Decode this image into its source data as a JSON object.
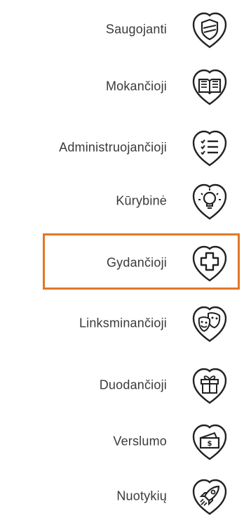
{
  "menu": {
    "items": [
      {
        "label": "Saugojanti",
        "icon": "shield-icon"
      },
      {
        "label": "Mokančioji",
        "icon": "book-icon"
      },
      {
        "label": "Administruojančioji",
        "icon": "list-icon"
      },
      {
        "label": "Kūrybinė",
        "icon": "lightbulb-icon"
      },
      {
        "label": "Gydančioji",
        "icon": "medical-cross-icon"
      },
      {
        "label": "Linksminančioji",
        "icon": "theater-masks-icon"
      },
      {
        "label": "Duodančioji",
        "icon": "gift-icon"
      },
      {
        "label": "Verslumo",
        "icon": "money-icon"
      },
      {
        "label": "Nuotykių",
        "icon": "rocket-icon"
      }
    ],
    "selected_index": 4,
    "highlight_color": "#e0772a",
    "text_color": "#3a3a3a",
    "icon_color": "#222222"
  }
}
